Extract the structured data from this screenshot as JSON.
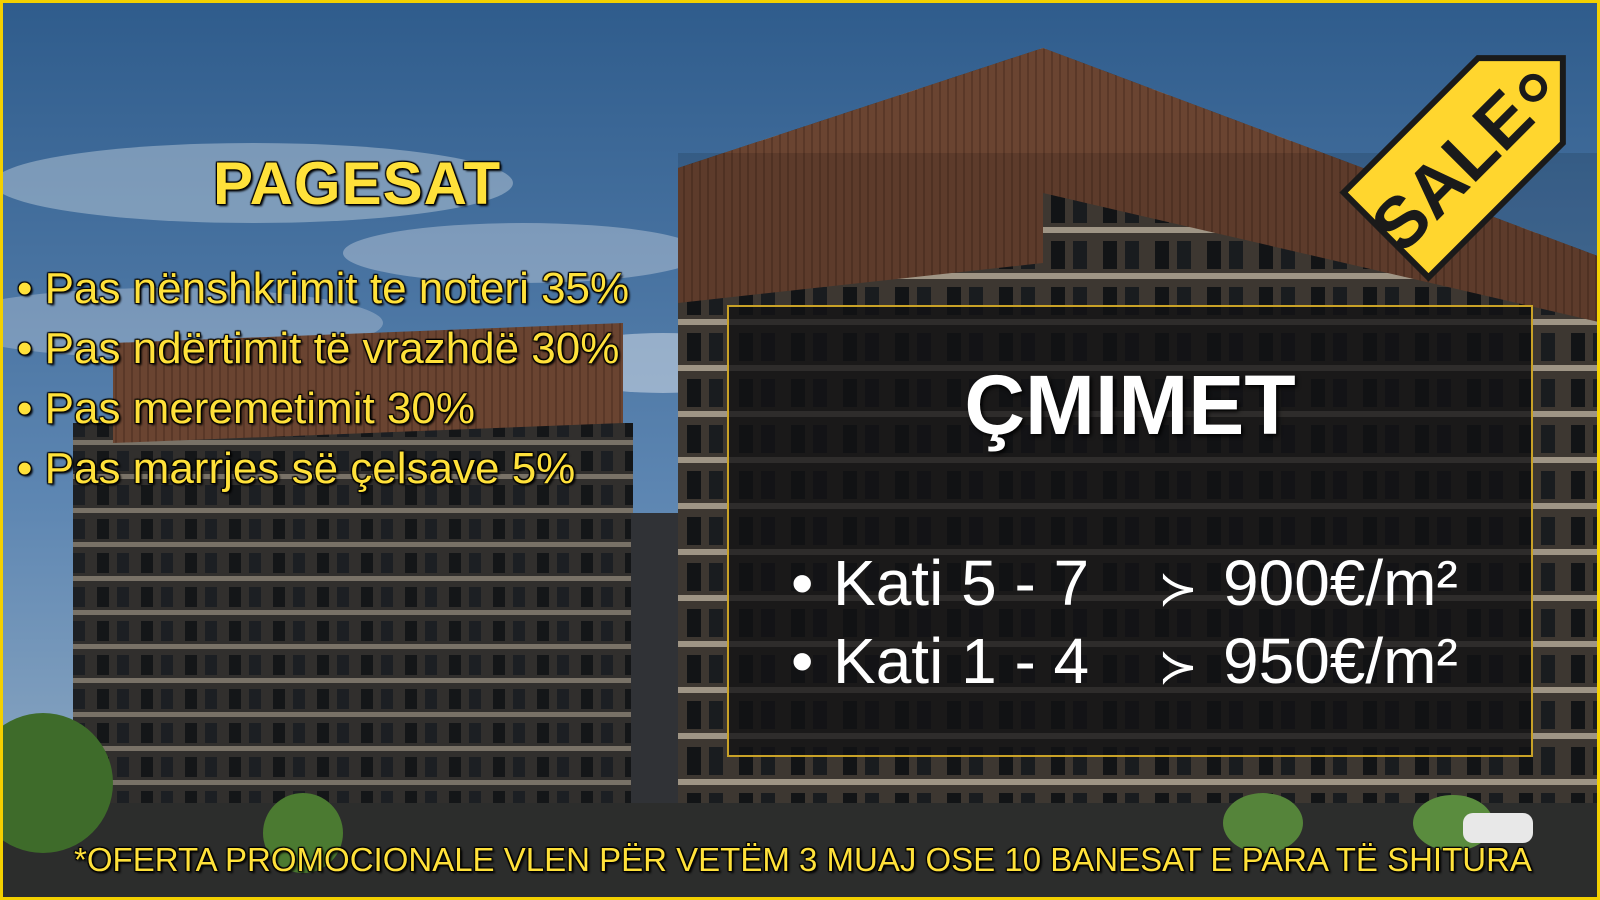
{
  "payments": {
    "title": "PAGESAT",
    "items": [
      {
        "bullet": "•",
        "text": "Pas nënshkrimit te noteri 35%"
      },
      {
        "bullet": "•",
        "text": "Pas ndërtimit të vrazhdë 30%"
      },
      {
        "bullet": "•",
        "text": "Pas meremetimit 30%"
      },
      {
        "bullet": "•",
        "text": "Pas marrjes së çelsave 5%"
      }
    ]
  },
  "prices": {
    "title": "ÇMIMET",
    "rows": [
      {
        "bullet": "•",
        "floors": "Kati 5 - 7",
        "arrow": "≻",
        "price": "900€/m²"
      },
      {
        "bullet": "•",
        "floors": "Kati 1 - 4",
        "arrow": "≻",
        "price": "950€/m²"
      }
    ]
  },
  "sale_tag": {
    "label": "SALE",
    "color": "#ffd62e"
  },
  "footer": "*OFERTA PROMOCIONALE VLEN PËR VETËM 3 MUAJ OSE 10 BANESAT E PARA TË SHITURA",
  "colors": {
    "accent_yellow": "#ffe13a",
    "frame": "#f3d000",
    "box_border": "#c9a227"
  }
}
